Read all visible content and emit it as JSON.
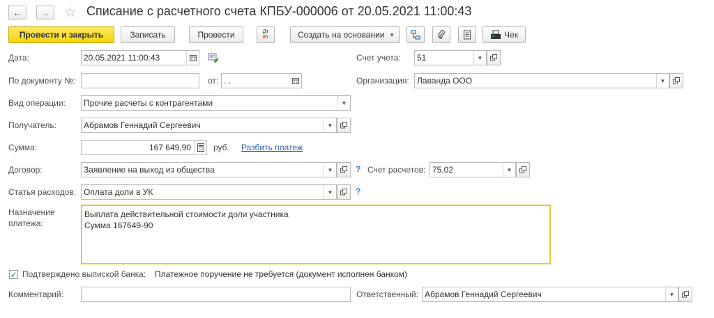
{
  "header": {
    "title": "Списание с расчетного счета КПБУ-000006 от 20.05.2021 11:00:43",
    "back_icon": "←",
    "forward_icon": "→",
    "star_icon": "☆"
  },
  "toolbar": {
    "post_close": "Провести и закрыть",
    "save": "Записать",
    "post": "Провести",
    "dtkt_top": "Дт",
    "dtkt_bottom": "Кт",
    "create_based": "Создать на основании",
    "cheque": "Чек"
  },
  "form": {
    "date_label": "Дата:",
    "date_value": "20.05.2021 11:00:43",
    "account_label": "Счет учета:",
    "account_value": "51",
    "doc_no_label": "По документу №:",
    "doc_no_value": "",
    "from_label": "от:",
    "from_value": " .  .",
    "org_label": "Организация:",
    "org_value": "Лаванда ООО",
    "op_label": "Вид операции:",
    "op_value": "Прочие расчеты с контрагентами",
    "recipient_label": "Получатель:",
    "recipient_value": "Абрамов Геннадий Сергеевич",
    "amount_label": "Сумма:",
    "amount_value": "167 649,90",
    "currency": "руб.",
    "split_link": "Разбить платеж",
    "contract_label": "Договор:",
    "contract_value": "Заявление на выход из общества",
    "settlement_label": "Счет расчетов:",
    "settlement_value": "75.02",
    "expense_label": "Статья расходов:",
    "expense_value": "Оплата доли в УК",
    "question": "?",
    "purpose_label_1": "Назначение",
    "purpose_label_2": "платежа:",
    "purpose_value": "Выплата действительной стоимости доли участника\nСумма 167649-90",
    "bank_confirmed_label": "Подтверждено выпиской банка:",
    "bank_confirmed_checked": true,
    "bank_note": "Платежное поручение не требуется (документ исполнен банком)",
    "comment_label": "Комментарий:",
    "comment_value": "",
    "responsible_label": "Ответственный:",
    "responsible_value": "Абрамов Геннадий Сергеевич"
  }
}
